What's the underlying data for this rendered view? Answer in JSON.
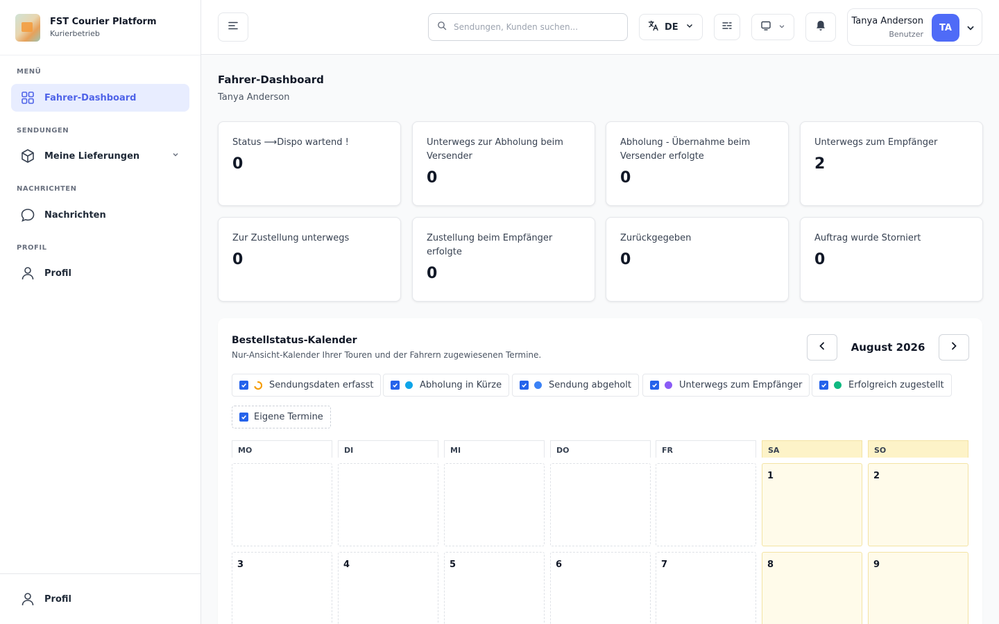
{
  "brand": {
    "title": "FST Courier Platform",
    "subtitle": "Kurierbetrieb"
  },
  "sidebar": {
    "sections": [
      {
        "label": "MENÜ"
      },
      {
        "label": "SENDUNGEN"
      },
      {
        "label": "NACHRICHTEN"
      },
      {
        "label": "PROFIL"
      }
    ],
    "items": [
      {
        "label": "Fahrer-Dashboard",
        "icon": "grid-icon",
        "active": true
      },
      {
        "label": "Meine Lieferungen",
        "icon": "box-icon"
      },
      {
        "label": "Nachrichten",
        "icon": "chat-icon"
      },
      {
        "label": "Profil",
        "icon": "user-icon"
      }
    ],
    "footer": {
      "label": "Profil"
    }
  },
  "header": {
    "search_placeholder": "Sendungen, Kunden suchen...",
    "language": "DE",
    "user": {
      "name": "Tanya Anderson",
      "role": "Benutzer",
      "initials": "TA"
    }
  },
  "main": {
    "title": "Fahrer-Dashboard",
    "subtitle": "Tanya Anderson",
    "cards": [
      {
        "label": "Status ⟶Dispo wartend !",
        "value": "0"
      },
      {
        "label": "Unterwegs zur Abholung beim Versender",
        "value": "0"
      },
      {
        "label": "Abholung - Übernahme beim Versender erfolgte",
        "value": "0"
      },
      {
        "label": "Unterwegs zum Empfänger",
        "value": "2"
      },
      {
        "label": "Zur Zustellung unterwegs",
        "value": "0"
      },
      {
        "label": "Zustellung beim Empfänger erfolgte",
        "value": "0"
      },
      {
        "label": "Zurückgegeben",
        "value": "0"
      },
      {
        "label": "Auftrag wurde Storniert",
        "value": "0"
      }
    ]
  },
  "calendar": {
    "title": "Bestellstatus-Kalender",
    "subtitle": "Nur-Ansicht-Kalender Ihrer Touren und der Fahrern zugewiesenen Termine.",
    "month": "August 2026",
    "legend": [
      {
        "label": "Sendungsdaten erfasst",
        "color": "#f59e0b"
      },
      {
        "label": "Abholung in Kürze",
        "color": "#0ea5e9"
      },
      {
        "label": "Sendung abgeholt",
        "color": "#3b82f6"
      },
      {
        "label": "Unterwegs zum Empfänger",
        "color": "#8b5cf6"
      },
      {
        "label": "Erfolgreich zugestellt",
        "color": "#10b981"
      },
      {
        "label": "Eigene Termine",
        "color": ""
      }
    ],
    "weekdays": [
      "MO",
      "DI",
      "MI",
      "DO",
      "FR",
      "SA",
      "SO"
    ],
    "week1": [
      "",
      "",
      "",
      "",
      "",
      "1",
      "2"
    ],
    "week2": [
      "3",
      "4",
      "5",
      "6",
      "7",
      "8",
      "9"
    ]
  }
}
